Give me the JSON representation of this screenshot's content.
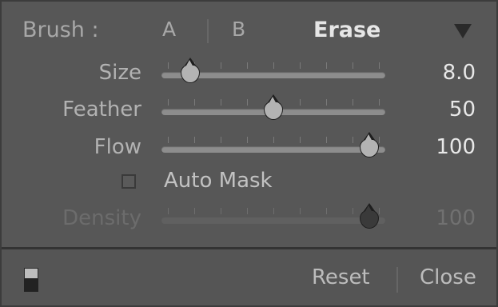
{
  "header": {
    "label": "Brush :",
    "options": [
      "A",
      "B",
      "Erase"
    ],
    "selected": "Erase",
    "collapse_icon": "triangle-down-icon"
  },
  "sliders": [
    {
      "id": "size",
      "label": "Size",
      "value": "8.0",
      "position_pct": 13,
      "enabled": true
    },
    {
      "id": "feather",
      "label": "Feather",
      "value": "50",
      "position_pct": 50,
      "enabled": true
    },
    {
      "id": "flow",
      "label": "Flow",
      "value": "100",
      "position_pct": 93,
      "enabled": true
    },
    {
      "id": "density",
      "label": "Density",
      "value": "100",
      "position_pct": 93,
      "enabled": false
    }
  ],
  "auto_mask": {
    "label": "Auto Mask",
    "checked": false
  },
  "footer": {
    "toggle_icon": "panel-switch-icon",
    "reset_label": "Reset",
    "close_label": "Close"
  }
}
